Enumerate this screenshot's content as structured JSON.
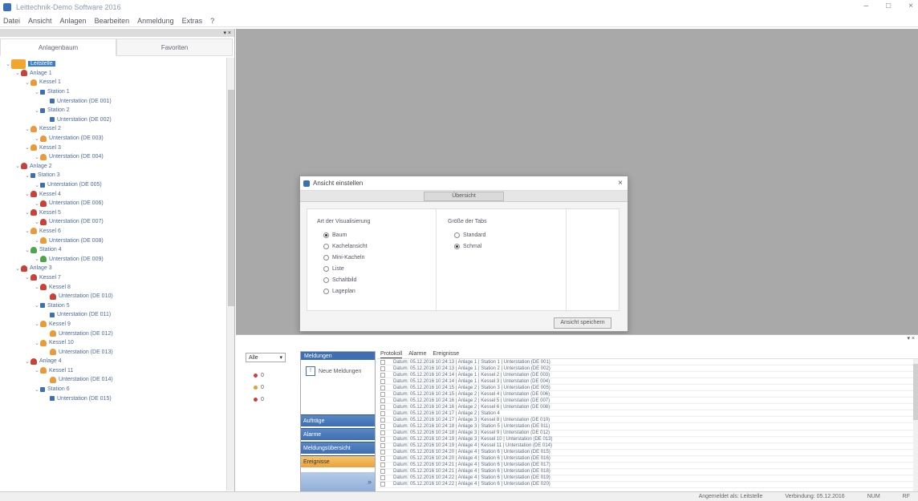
{
  "window": {
    "title": "Leittechnik-Demo Software 2016",
    "controls": {
      "minimize": "–",
      "maximize": "□",
      "close": "×"
    }
  },
  "menu": [
    "Datei",
    "Ansicht",
    "Anlagen",
    "Bearbeiten",
    "Anmeldung",
    "Extras",
    "?"
  ],
  "left_pane": {
    "pin_label": "▾ ×",
    "tabs": [
      {
        "label": "Anlagenbaum",
        "active": true
      },
      {
        "label": "Favoriten",
        "active": false
      }
    ],
    "tree": [
      {
        "level": 0,
        "icon": "root",
        "label": "Leitstelle",
        "selected": true
      },
      {
        "level": 1,
        "icon": "red",
        "label": "Anlage 1"
      },
      {
        "level": 2,
        "icon": "orange",
        "label": "Kessel 1"
      },
      {
        "level": 3,
        "icon": "node",
        "label": "Station 1"
      },
      {
        "level": 4,
        "icon": "node",
        "label": "Unterstation (DE 001)"
      },
      {
        "level": 3,
        "icon": "node",
        "label": "Station 2"
      },
      {
        "level": 4,
        "icon": "node",
        "label": "Unterstation (DE 002)"
      },
      {
        "level": 2,
        "icon": "orange",
        "label": "Kessel 2"
      },
      {
        "level": 3,
        "icon": "orange",
        "label": "Unterstation (DE 003)"
      },
      {
        "level": 2,
        "icon": "orange",
        "label": "Kessel 3"
      },
      {
        "level": 3,
        "icon": "orange",
        "label": "Unterstation (DE 004)"
      },
      {
        "level": 1,
        "icon": "red",
        "label": "Anlage 2"
      },
      {
        "level": 2,
        "icon": "node",
        "label": "Station 3"
      },
      {
        "level": 3,
        "icon": "node",
        "label": "Unterstation (DE 005)"
      },
      {
        "level": 2,
        "icon": "red",
        "label": "Kessel 4"
      },
      {
        "level": 3,
        "icon": "red",
        "label": "Unterstation (DE 006)"
      },
      {
        "level": 2,
        "icon": "red",
        "label": "Kessel 5"
      },
      {
        "level": 3,
        "icon": "red",
        "label": "Unterstation (DE 007)"
      },
      {
        "level": 2,
        "icon": "orange",
        "label": "Kessel 6"
      },
      {
        "level": 3,
        "icon": "orange",
        "label": "Unterstation (DE 008)"
      },
      {
        "level": 2,
        "icon": "green",
        "label": "Station 4"
      },
      {
        "level": 3,
        "icon": "green",
        "label": "Unterstation (DE 009)"
      },
      {
        "level": 1,
        "icon": "red",
        "label": "Anlage 3"
      },
      {
        "level": 2,
        "icon": "red",
        "label": "Kessel 7"
      },
      {
        "level": 3,
        "icon": "red",
        "label": "Kessel 8"
      },
      {
        "level": 4,
        "icon": "red",
        "label": "Unterstation (DE 010)"
      },
      {
        "level": 3,
        "icon": "node",
        "label": "Station 5"
      },
      {
        "level": 4,
        "icon": "node",
        "label": "Unterstation (DE 011)"
      },
      {
        "level": 3,
        "icon": "orange",
        "label": "Kessel 9"
      },
      {
        "level": 4,
        "icon": "orange",
        "label": "Unterstation (DE 012)"
      },
      {
        "level": 3,
        "icon": "orange",
        "label": "Kessel 10"
      },
      {
        "level": 4,
        "icon": "orange",
        "label": "Unterstation (DE 013)"
      },
      {
        "level": 2,
        "icon": "red",
        "label": "Anlage 4"
      },
      {
        "level": 3,
        "icon": "orange",
        "label": "Kessel 11"
      },
      {
        "level": 4,
        "icon": "orange",
        "label": "Unterstation (DE 014)"
      },
      {
        "level": 3,
        "icon": "node",
        "label": "Station 6"
      },
      {
        "level": 4,
        "icon": "node",
        "label": "Unterstation (DE 015)"
      }
    ]
  },
  "dialog": {
    "title": "Ansicht einstellen",
    "close": "×",
    "tab": "Übersicht",
    "group1": {
      "title": "Art der Visualisierung",
      "options": [
        {
          "label": "Baum",
          "checked": true
        },
        {
          "label": "Kachelansicht",
          "checked": false
        },
        {
          "label": "Mini-Kacheln",
          "checked": false
        },
        {
          "label": "Liste",
          "checked": false
        },
        {
          "label": "Schaltbild",
          "checked": false
        },
        {
          "label": "Lageplan",
          "checked": false
        }
      ]
    },
    "group2": {
      "title": "Größe der Tabs",
      "options": [
        {
          "label": "Standard",
          "checked": false
        },
        {
          "label": "Schmal",
          "checked": true
        }
      ]
    },
    "button": "Ansicht speichern"
  },
  "bottom": {
    "pin_label": "▾ ×",
    "select_value": "Alle",
    "statuses": [
      {
        "color": "#c8413a",
        "label": "0"
      },
      {
        "color": "#e99a3a",
        "label": "0"
      },
      {
        "color": "#c8413a",
        "label": "0"
      }
    ],
    "nav": {
      "title": "Meldungen",
      "item": "Neue Meldungen",
      "sections": [
        {
          "label": "Aufträge",
          "active": false
        },
        {
          "label": "Alarme",
          "active": false
        },
        {
          "label": "Meldungsübersicht",
          "active": false
        },
        {
          "label": "Ereignisse",
          "active": true
        }
      ]
    },
    "log_tabs": [
      "Protokoll",
      "Alarme",
      "Ereignisse"
    ],
    "log_rows": [
      "Datum: 05.12.2016 10:24:13 | Anlage 1 | Station 1 | Unterstation (DE 001)",
      "Datum: 05.12.2016 10:24:13 | Anlage 1 | Station 2 | Unterstation (DE 002)",
      "Datum: 05.12.2016 10:24:14 | Anlage 1 | Kessel 2 | Unterstation (DE 003)",
      "Datum: 05.12.2016 10:24:14 | Anlage 1 | Kessel 3 | Unterstation (DE 004)",
      "Datum: 05.12.2016 10:24:15 | Anlage 2 | Station 3 | Unterstation (DE 005)",
      "Datum: 05.12.2016 10:24:15 | Anlage 2 | Kessel 4 | Unterstation (DE 006)",
      "Datum: 05.12.2016 10:24:16 | Anlage 2 | Kessel 5 | Unterstation (DE 007)",
      "Datum: 05.12.2016 10:24:16 | Anlage 2 | Kessel 6 | Unterstation (DE 008)",
      "Datum: 05.12.2016 10:24:17 | Anlage 2 | Station 4",
      "Datum: 05.12.2016 10:24:17 | Anlage 3 | Kessel 8 | Unterstation (DE 010)",
      "Datum: 05.12.2016 10:24:18 | Anlage 3 | Station 5 | Unterstation (DE 011)",
      "Datum: 05.12.2016 10:24:18 | Anlage 3 | Kessel 9 | Unterstation (DE 012)",
      "Datum: 05.12.2016 10:24:19 | Anlage 3 | Kessel 10 | Unterstation (DE 013)",
      "Datum: 05.12.2016 10:24:19 | Anlage 4 | Kessel 11 | Unterstation (DE 014)",
      "Datum: 05.12.2016 10:24:20 | Anlage 4 | Station 6 | Unterstation (DE 015)",
      "Datum: 05.12.2016 10:24:20 | Anlage 4 | Station 6 | Unterstation (DE 016)",
      "Datum: 05.12.2016 10:24:21 | Anlage 4 | Station 6 | Unterstation (DE 017)",
      "Datum: 05.12.2016 10:24:21 | Anlage 4 | Station 6 | Unterstation (DE 018)",
      "Datum: 05.12.2016 10:24:22 | Anlage 4 | Station 6 | Unterstation (DE 019)",
      "Datum: 05.12.2016 10:24:22 | Anlage 4 | Station 6 | Unterstation (DE 020)"
    ]
  },
  "statusbar": [
    "Angemeldet als: Leitstelle",
    "Verbindung: 05.12.2016",
    "NUM",
    "RF"
  ]
}
